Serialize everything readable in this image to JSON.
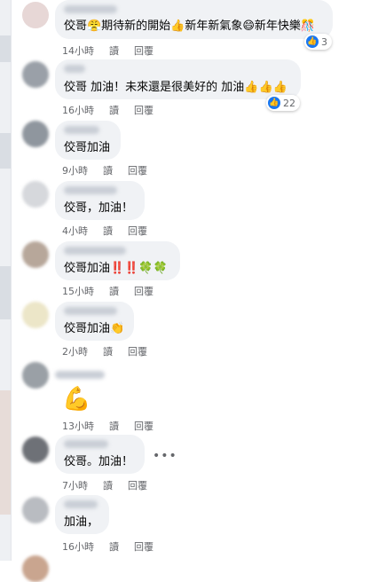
{
  "comments": [
    {
      "text": "佼哥😤期待新的開始👍新年新氣象😄新年快樂🎊",
      "time": "14小時",
      "read": "讀",
      "reply": "回覆",
      "reactions": "3",
      "reaction_icon": "like-icon"
    },
    {
      "text": "佼哥 加油！未來還是很美好的 加油👍👍👍",
      "time": "16小時",
      "read": "讀",
      "reply": "回覆",
      "reactions": "22",
      "reaction_icon": "like-icon"
    },
    {
      "text": "佼哥加油",
      "time": "9小時",
      "read": "讀",
      "reply": "回覆"
    },
    {
      "text": "佼哥，加油！",
      "time": "4小時",
      "read": "讀",
      "reply": "回覆"
    },
    {
      "text": "佼哥加油‼️‼️🍀🍀",
      "time": "15小時",
      "read": "讀",
      "reply": "回覆"
    },
    {
      "text": "佼哥加油👏",
      "time": "2小時",
      "read": "讀",
      "reply": "回覆"
    },
    {
      "text": "💪",
      "time": "13小時",
      "read": "讀",
      "reply": "回覆"
    },
    {
      "text": "佼哥。加油！",
      "time": "7小時",
      "read": "讀",
      "reply": "回覆"
    },
    {
      "text": "加油，",
      "time": "16小時",
      "read": "讀",
      "reply": "回覆"
    }
  ],
  "more_menu": "•••",
  "colors": {
    "bubble": "#f0f2f5",
    "meta": "#65676b",
    "like": "#1877f2"
  }
}
